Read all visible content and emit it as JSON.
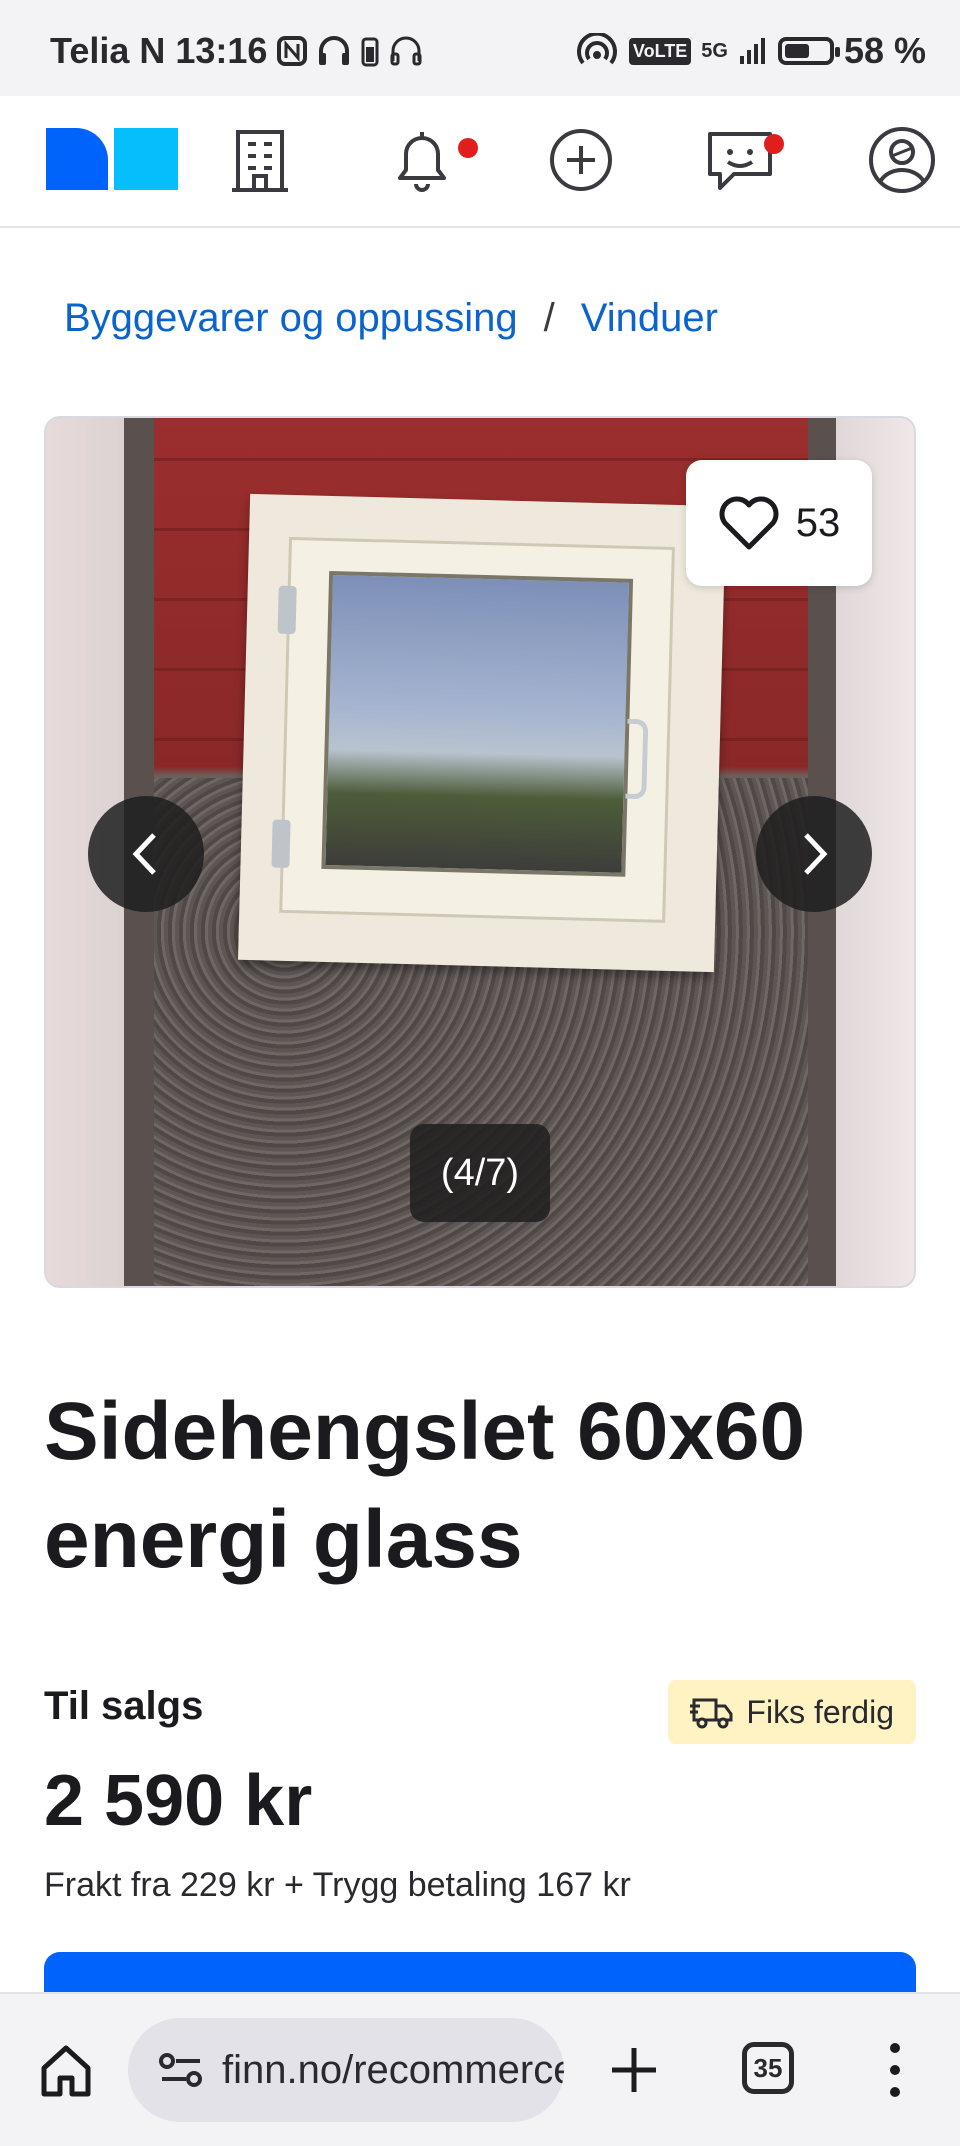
{
  "status_bar": {
    "carrier": "Telia N",
    "time": "13:16",
    "network": "5G",
    "volte": "VoLTE",
    "hotspot_count": "1",
    "battery": "58 %",
    "battery_level": 0.58
  },
  "top_nav": {
    "icons": [
      "logo",
      "building-icon",
      "bell-icon",
      "add-circle-icon",
      "chat-icon",
      "profile-icon"
    ],
    "accent": "#0063fb",
    "notification_dot_color": "#e01e1e"
  },
  "breadcrumb": {
    "items": [
      "Byggevarer og oppussing",
      "Vinduer"
    ],
    "separator": "/"
  },
  "gallery": {
    "favorite_count": "53",
    "counter": "(4/7)"
  },
  "listing": {
    "title": "Sidehengslet 60x60 energi glass",
    "status": "Til salgs",
    "badge": "Fiks ferdig",
    "badge_color": "#fff3c4",
    "price": "2 590 kr",
    "shipping": "Frakt fra 229 kr + Trygg betaling 167 kr"
  },
  "browser_bar": {
    "url": "finn.no/recommerce",
    "tab_count": "35"
  }
}
